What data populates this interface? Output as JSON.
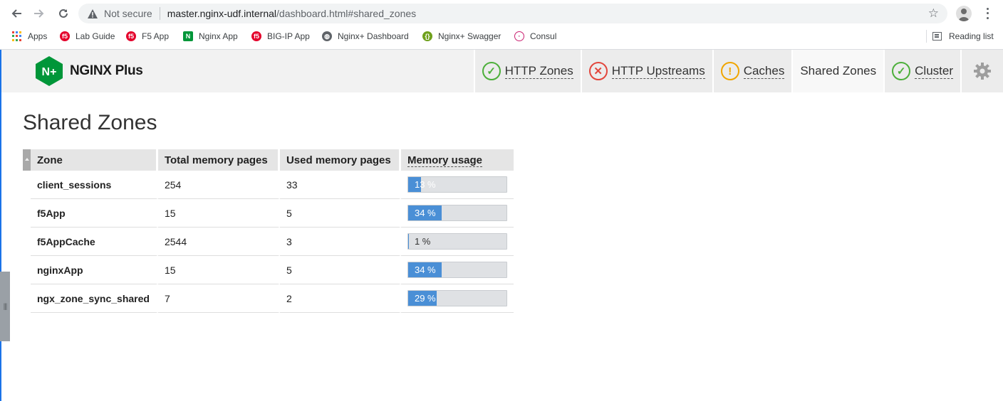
{
  "browser": {
    "security_label": "Not secure",
    "url_host": "master.nginx-udf.internal",
    "url_path": "/dashboard.html#shared_zones",
    "bookmarks": [
      {
        "label": "Apps",
        "icon": "apps-grid-icon"
      },
      {
        "label": "Lab Guide",
        "icon": "f5-logo-icon"
      },
      {
        "label": "F5 App",
        "icon": "f5-logo-icon"
      },
      {
        "label": "Nginx App",
        "icon": "nginx-logo-icon"
      },
      {
        "label": "BIG-IP App",
        "icon": "f5-logo-icon"
      },
      {
        "label": "Nginx+ Dashboard",
        "icon": "globe-icon"
      },
      {
        "label": "Nginx+ Swagger",
        "icon": "swagger-logo-icon"
      },
      {
        "label": "Consul",
        "icon": "consul-logo-icon"
      }
    ],
    "reading_list": "Reading list"
  },
  "header": {
    "logo_mark": "N+",
    "logo_text": "NGINX Plus",
    "tabs": [
      {
        "label": "HTTP Zones",
        "status": "ok"
      },
      {
        "label": "HTTP Upstreams",
        "status": "error"
      },
      {
        "label": "Caches",
        "status": "warning"
      },
      {
        "label": "Shared Zones",
        "status": "active"
      },
      {
        "label": "Cluster",
        "status": "ok"
      }
    ]
  },
  "main": {
    "title": "Shared Zones",
    "columns": [
      "Zone",
      "Total memory pages",
      "Used memory pages",
      "Memory usage"
    ],
    "rows": [
      {
        "zone": "client_sessions",
        "total": "254",
        "used": "33",
        "usage_pct": 13,
        "usage_label": "13 %"
      },
      {
        "zone": "f5App",
        "total": "15",
        "used": "5",
        "usage_pct": 34,
        "usage_label": "34 %"
      },
      {
        "zone": "f5AppCache",
        "total": "2544",
        "used": "3",
        "usage_pct": 1,
        "usage_label": "1 %"
      },
      {
        "zone": "nginxApp",
        "total": "15",
        "used": "5",
        "usage_pct": 34,
        "usage_label": "34 %"
      },
      {
        "zone": "ngx_zone_sync_shared",
        "total": "7",
        "used": "2",
        "usage_pct": 29,
        "usage_label": "29 %"
      }
    ]
  },
  "colors": {
    "bar_fill": "#4a8fd6",
    "nginx_green": "#009639",
    "status_ok": "#4caf3a",
    "status_error": "#e2463c",
    "status_warning": "#f0a500"
  }
}
